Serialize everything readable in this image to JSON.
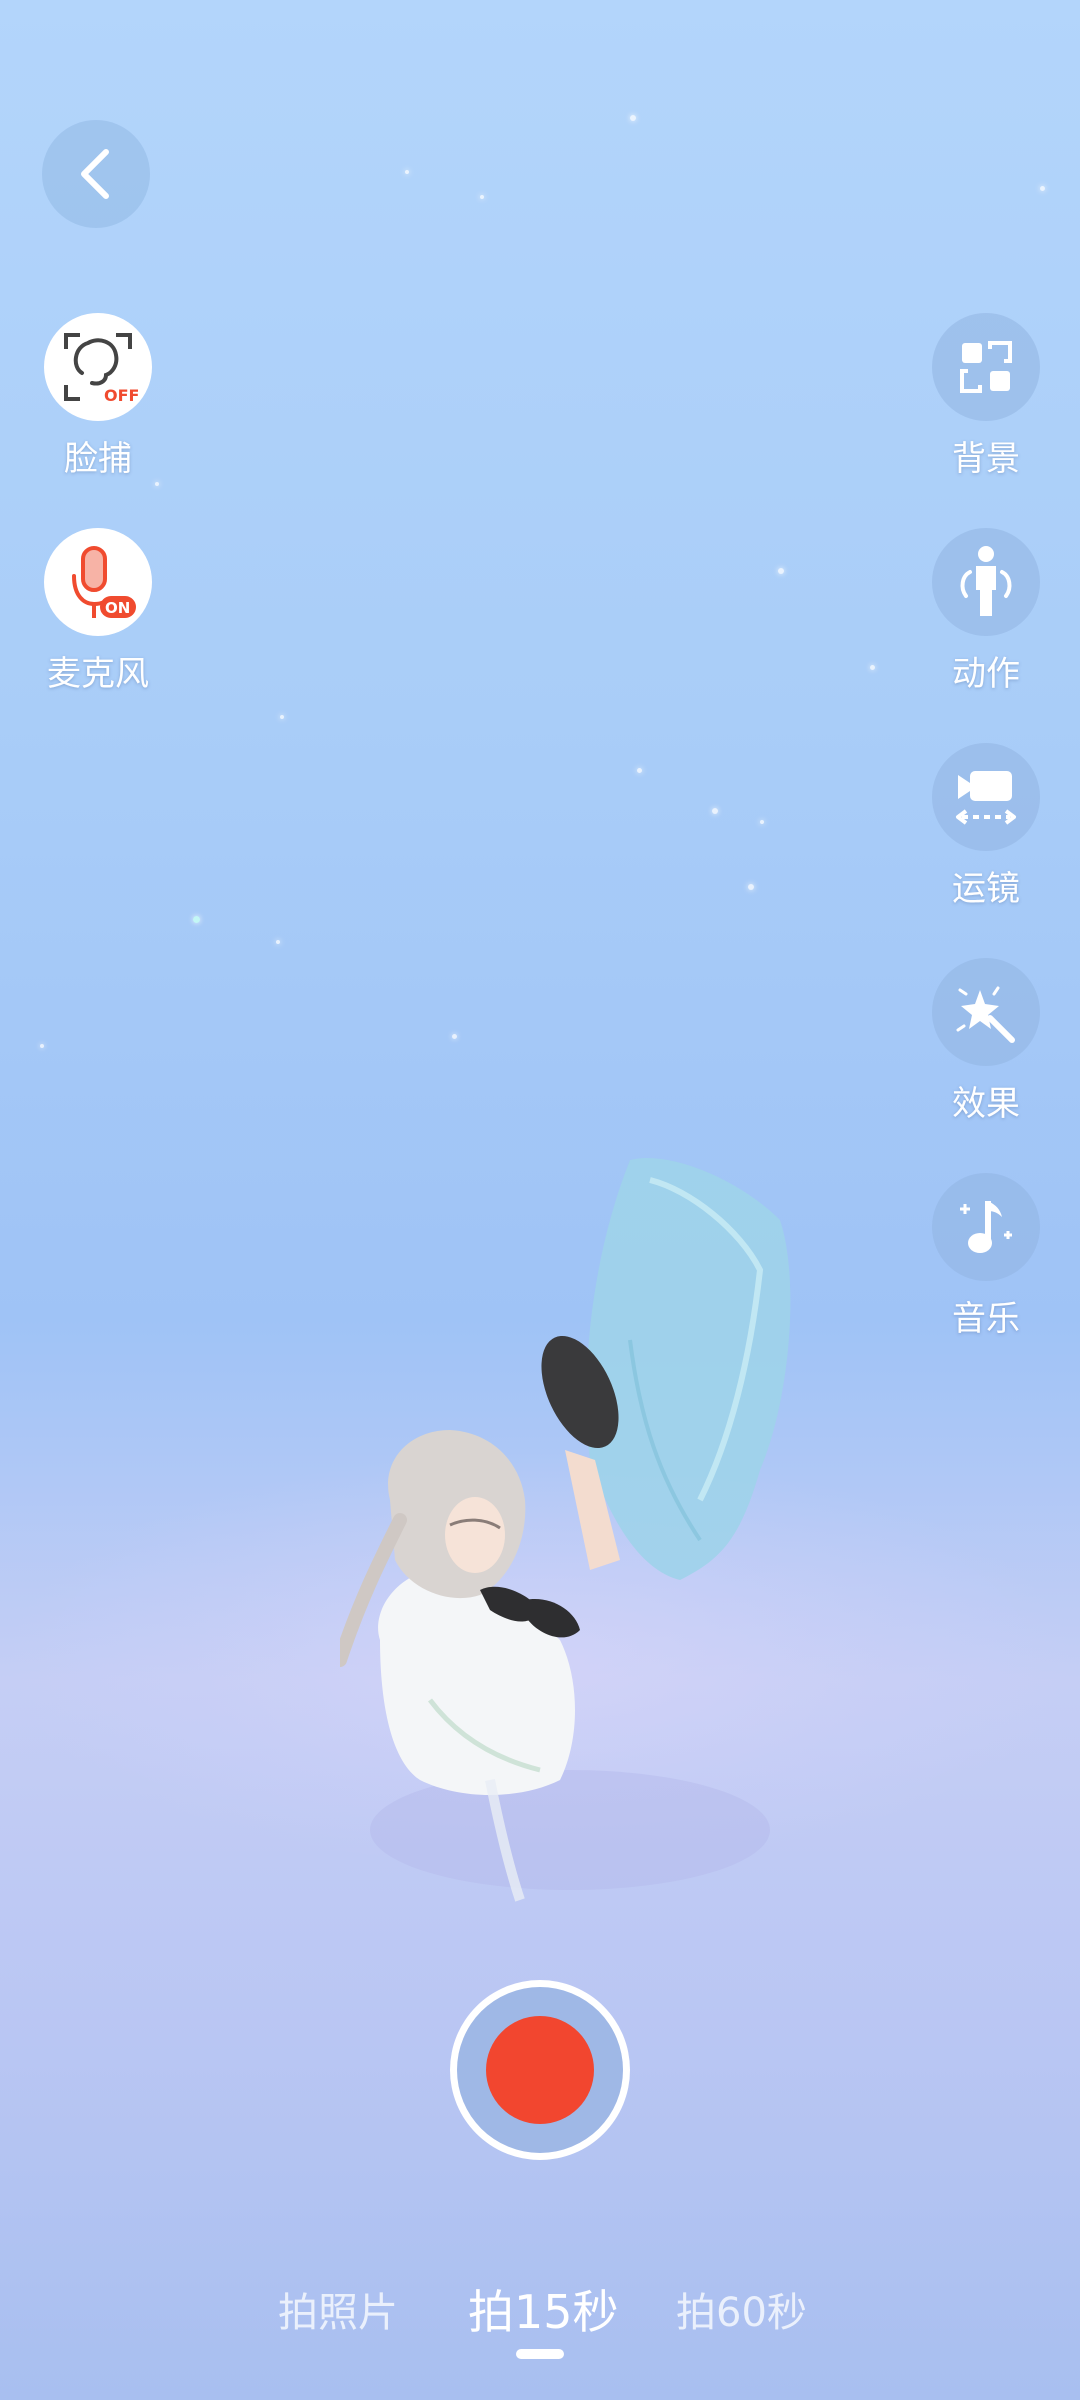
{
  "back": {
    "icon": "chevron-left-icon"
  },
  "left_tools": [
    {
      "label": "脸捕",
      "icon": "face-capture-icon",
      "status": "OFF",
      "status_color": "#f04b2f"
    },
    {
      "label": "麦克风",
      "icon": "microphone-icon",
      "status": "ON",
      "status_color": "#f04b2f"
    }
  ],
  "right_tools": [
    {
      "label": "背景",
      "icon": "background-icon"
    },
    {
      "label": "动作",
      "icon": "pose-icon"
    },
    {
      "label": "运镜",
      "icon": "camera-movement-icon"
    },
    {
      "label": "效果",
      "icon": "effects-icon"
    },
    {
      "label": "音乐",
      "icon": "music-icon"
    }
  ],
  "record": {
    "icon": "record-button",
    "color": "#f2462f"
  },
  "modes": [
    {
      "label": "拍照片",
      "active": false
    },
    {
      "label": "拍15秒",
      "active": true
    },
    {
      "label": "拍60秒",
      "active": false
    }
  ],
  "colors": {
    "accent_red": "#f2462f",
    "background_top": "#b3d5fb",
    "background_bottom": "#a8bff0"
  }
}
